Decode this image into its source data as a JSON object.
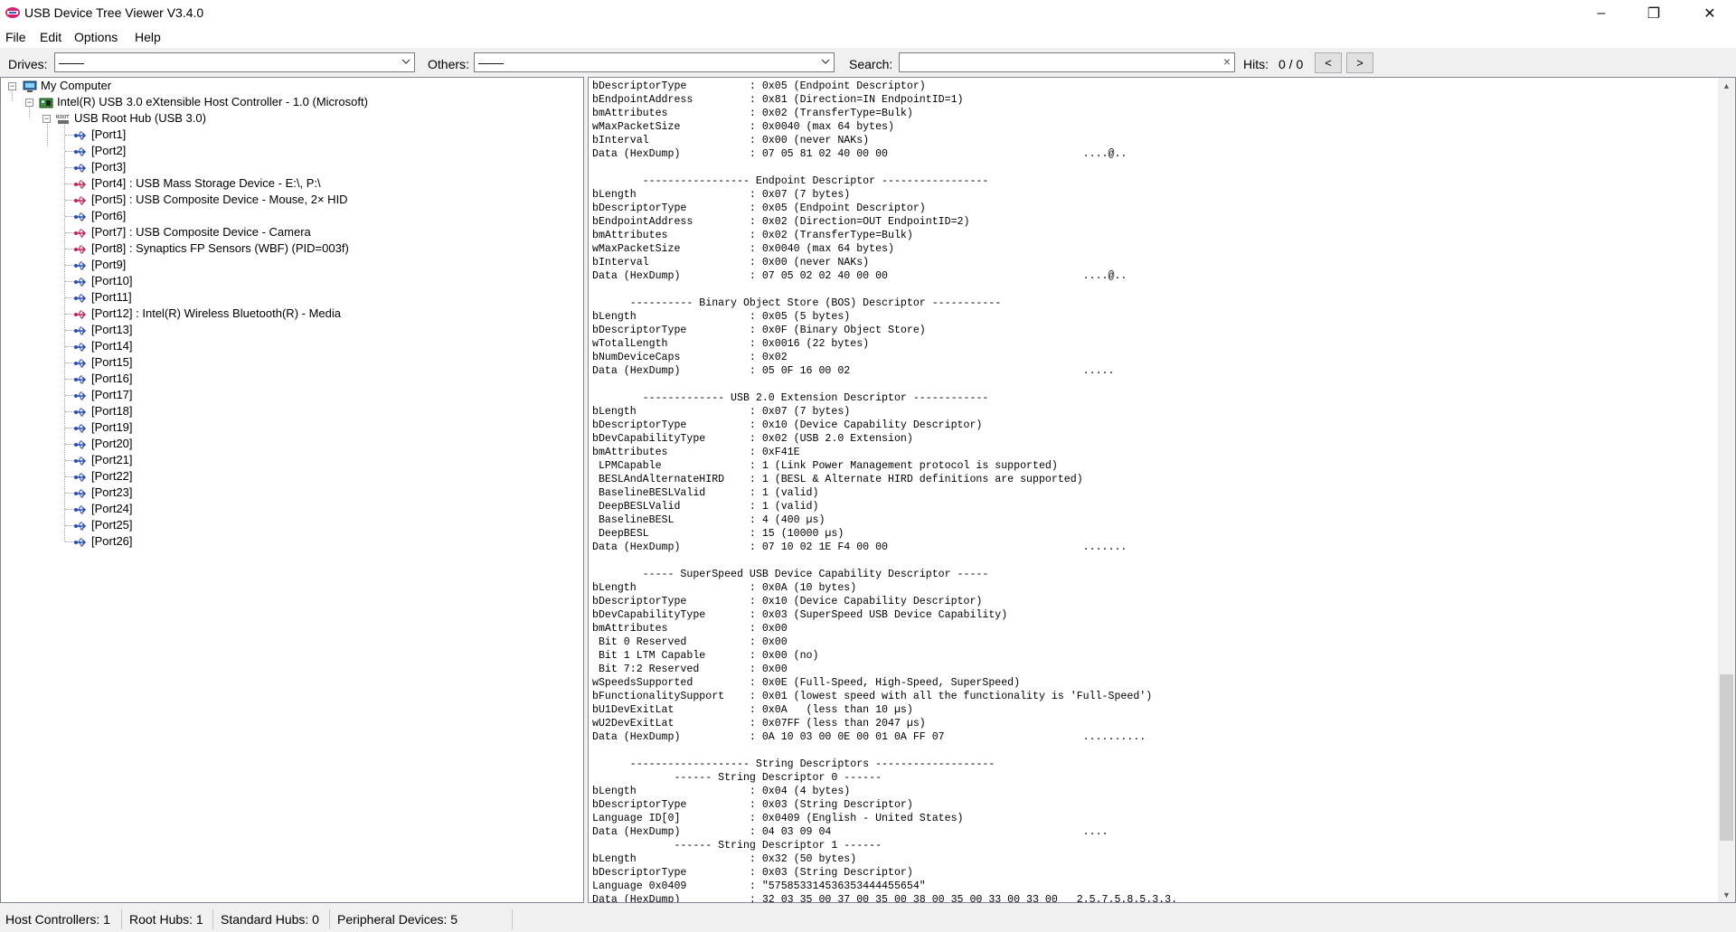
{
  "window": {
    "title": "USB Device Tree Viewer V3.4.0",
    "controls": {
      "minimize": "–",
      "maximize": "❐",
      "close": "✕"
    }
  },
  "menu": {
    "file": "File",
    "edit": "Edit",
    "options": "Options",
    "help": "Help"
  },
  "toolbar": {
    "drives_label": "Drives:",
    "drives_value": "——",
    "others_label": "Others:",
    "others_value": "——",
    "search_label": "Search:",
    "search_value": "",
    "search_clear": "×",
    "hits_label": "Hits:",
    "hits_value": "0 / 0",
    "prev": "<",
    "next": ">"
  },
  "tree": {
    "root": "My Computer",
    "controller": "Intel(R) USB 3.0 eXtensible Host Controller - 1.0 (Microsoft)",
    "hub": "USB Root Hub (USB 3.0)",
    "ports": [
      "[Port1]",
      "[Port2]",
      "[Port3]",
      "[Port4] : USB Mass Storage Device - E:\\, P:\\",
      "[Port5] : USB Composite Device - Mouse, 2× HID",
      "[Port6]",
      "[Port7] : USB Composite Device - Camera",
      "[Port8] : Synaptics FP Sensors (WBF) (PID=003f)",
      "[Port9]",
      "[Port10]",
      "[Port11]",
      "[Port12] : Intel(R) Wireless Bluetooth(R) - Media",
      "[Port13]",
      "[Port14]",
      "[Port15]",
      "[Port16]",
      "[Port17]",
      "[Port18]",
      "[Port19]",
      "[Port20]",
      "[Port21]",
      "[Port22]",
      "[Port23]",
      "[Port24]",
      "[Port25]",
      "[Port26]"
    ]
  },
  "details_text": "bDescriptorType          : 0x05 (Endpoint Descriptor)\nbEndpointAddress         : 0x81 (Direction=IN EndpointID=1)\nbmAttributes             : 0x02 (TransferType=Bulk)\nwMaxPacketSize           : 0x0040 (max 64 bytes)\nbInterval                : 0x00 (never NAKs)\nData (HexDump)           : 07 05 81 02 40 00 00                               ....@..\n\n        ----------------- Endpoint Descriptor -----------------\nbLength                  : 0x07 (7 bytes)\nbDescriptorType          : 0x05 (Endpoint Descriptor)\nbEndpointAddress         : 0x02 (Direction=OUT EndpointID=2)\nbmAttributes             : 0x02 (TransferType=Bulk)\nwMaxPacketSize           : 0x0040 (max 64 bytes)\nbInterval                : 0x00 (never NAKs)\nData (HexDump)           : 07 05 02 02 40 00 00                               ....@..\n\n      ---------- Binary Object Store (BOS) Descriptor -----------\nbLength                  : 0x05 (5 bytes)\nbDescriptorType          : 0x0F (Binary Object Store)\nwTotalLength             : 0x0016 (22 bytes)\nbNumDeviceCaps           : 0x02\nData (HexDump)           : 05 0F 16 00 02                                     .....\n\n        ------------- USB 2.0 Extension Descriptor ------------\nbLength                  : 0x07 (7 bytes)\nbDescriptorType          : 0x10 (Device Capability Descriptor)\nbDevCapabilityType       : 0x02 (USB 2.0 Extension)\nbmAttributes             : 0xF41E\n LPMCapable              : 1 (Link Power Management protocol is supported)\n BESLAndAlternateHIRD    : 1 (BESL & Alternate HIRD definitions are supported)\n BaselineBESLValid       : 1 (valid)\n DeepBESLValid           : 1 (valid)\n BaselineBESL            : 4 (400 µs)\n DeepBESL                : 15 (10000 µs)\nData (HexDump)           : 07 10 02 1E F4 00 00                               .......\n\n        ----- SuperSpeed USB Device Capability Descriptor -----\nbLength                  : 0x0A (10 bytes)\nbDescriptorType          : 0x10 (Device Capability Descriptor)\nbDevCapabilityType       : 0x03 (SuperSpeed USB Device Capability)\nbmAttributes             : 0x00\n Bit 0 Reserved          : 0x00\n Bit 1 LTM Capable       : 0x00 (no)\n Bit 7:2 Reserved        : 0x00\nwSpeedsSupported         : 0x0E (Full-Speed, High-Speed, SuperSpeed)\nbFunctionalitySupport    : 0x01 (lowest speed with all the functionality is 'Full-Speed')\nbU1DevExitLat            : 0x0A   (less than 10 µs)\nwU2DevExitLat            : 0x07FF (less than 2047 µs)\nData (HexDump)           : 0A 10 03 00 0E 00 01 0A FF 07                      ..........\n\n      ------------------- String Descriptors -------------------\n             ------ String Descriptor 0 ------\nbLength                  : 0x04 (4 bytes)\nbDescriptorType          : 0x03 (String Descriptor)\nLanguage ID[0]           : 0x0409 (English - United States)\nData (HexDump)           : 04 03 09 04                                        ....\n             ------ String Descriptor 1 ------\nbLength                  : 0x32 (50 bytes)\nbDescriptorType          : 0x03 (String Descriptor)\nLanguage 0x0409          : \"575853314536353444455654\"\nData (HexDump)           : 32 03 35 00 37 00 35 00 38 00 35 00 33 00 33 00   2.5.7.5.8.5.3.3.",
  "statusbar": {
    "host_controllers": "Host Controllers: 1",
    "root_hubs": "Root Hubs: 1",
    "standard_hubs": "Standard Hubs: 0",
    "peripheral_devices": "Peripheral Devices: 5"
  }
}
